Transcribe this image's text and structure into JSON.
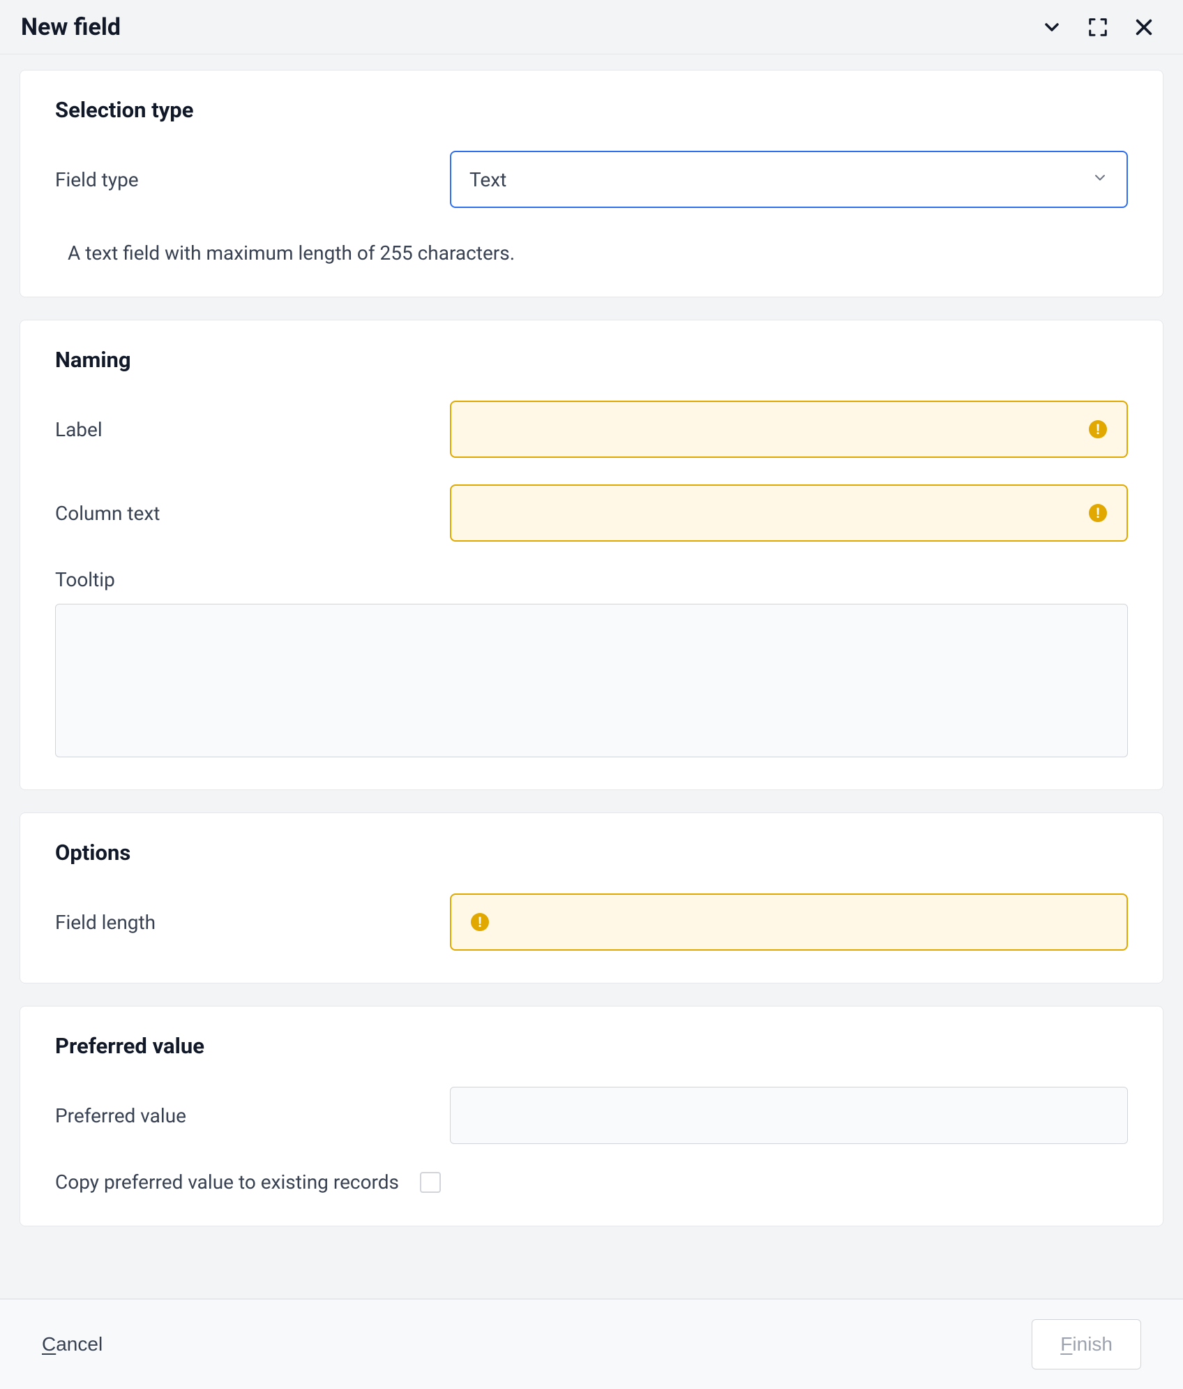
{
  "header": {
    "title": "New field"
  },
  "sections": {
    "selection": {
      "title": "Selection type",
      "field_type_label": "Field type",
      "field_type_value": "Text",
      "help": "A text field with maximum length of 255 characters."
    },
    "naming": {
      "title": "Naming",
      "label_label": "Label",
      "label_value": "",
      "column_label": "Column text",
      "column_value": "",
      "tooltip_label": "Tooltip",
      "tooltip_value": ""
    },
    "options": {
      "title": "Options",
      "field_length_label": "Field length",
      "field_length_value": ""
    },
    "preferred": {
      "title": "Preferred value",
      "value_label": "Preferred value",
      "value_value": "",
      "copy_label": "Copy preferred value to existing records",
      "copy_checked": false
    }
  },
  "footer": {
    "cancel": "Cancel",
    "finish": "Finish"
  }
}
